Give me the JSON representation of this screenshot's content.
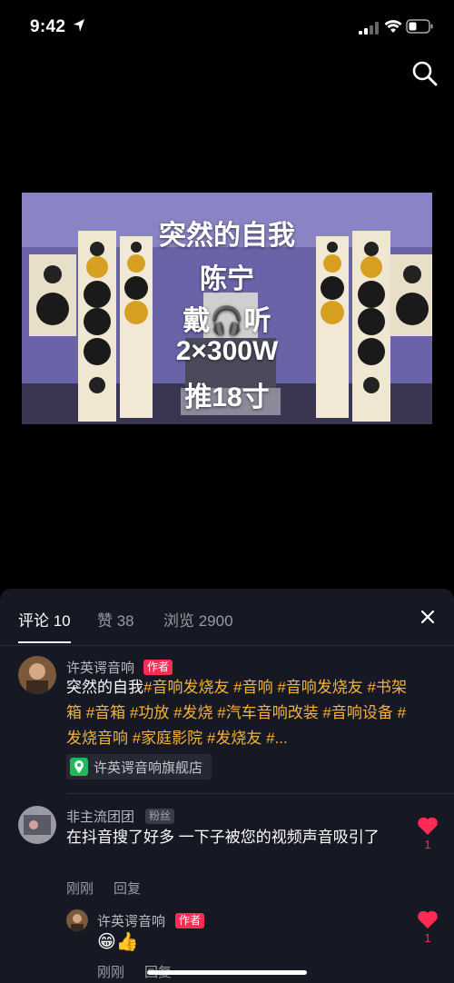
{
  "status": {
    "time": "9:42"
  },
  "video": {
    "lines": [
      "突然的自我",
      "陈宁",
      "戴🎧听",
      "2×300W",
      "推18寸"
    ]
  },
  "panel": {
    "tabs": [
      {
        "label": "评论 10"
      },
      {
        "label": "赞 38"
      },
      {
        "label": "浏览 2900"
      }
    ]
  },
  "post": {
    "author": "许英谔音响",
    "author_badge": "作者",
    "caption_text": "突然的自我",
    "caption_tags": "#音响发烧友 #音响 #音响发烧友 #书架箱 #音箱 #功放 #发烧 #汽车音响改装 #音响设备 #发烧音响 #家庭影院 #发烧友 #...",
    "store": "许英谔音响旗舰店"
  },
  "comments": [
    {
      "user": "非主流团团",
      "badge": "粉丝",
      "text": "在抖音搜了好多 一下子被您的视频声音吸引了",
      "time": "刚刚",
      "reply": "回复",
      "likes": "1"
    }
  ],
  "reply": {
    "user": "许英谔音响",
    "badge": "作者",
    "text": "😁👍",
    "time": "刚刚",
    "reply": "回复",
    "likes": "1"
  },
  "colors": {
    "accent": "#fe2c55",
    "tag": "#f5b33a",
    "panel_bg": "#161823"
  }
}
